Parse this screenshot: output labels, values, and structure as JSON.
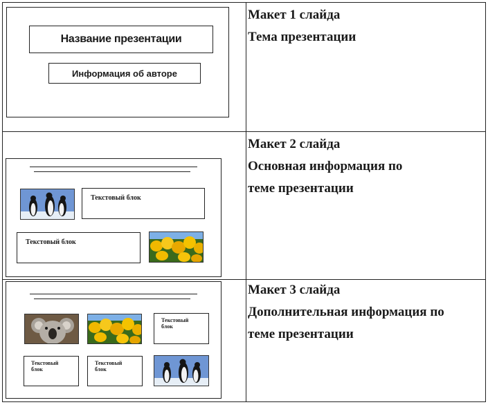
{
  "rows": [
    {
      "heading": "Макет 1 слайда",
      "lines": [
        "Тема презентации"
      ]
    },
    {
      "heading": "Макет 2 слайда",
      "lines": [
        "Основная информация по",
        "теме презентации"
      ]
    },
    {
      "heading": "Макет 3 слайда",
      "lines": [
        "Дополнительная информация по",
        "теме презентации"
      ]
    }
  ],
  "slide1": {
    "title_box": "Название презентации",
    "author_box": "Информация  об авторе"
  },
  "slide2": {
    "text_box_1": "Текстовый блок",
    "text_box_2": "Текстовый блок",
    "images": [
      "penguins",
      "tulips"
    ]
  },
  "slide3": {
    "text_box_1": [
      "Текстовый",
      "блок"
    ],
    "text_box_2": [
      "Текстовый",
      "блок"
    ],
    "text_box_3": [
      "Текстовый",
      "блок"
    ],
    "images": [
      "koala",
      "tulips",
      "penguins"
    ]
  },
  "colors": {
    "border": "#222222",
    "text": "#1a1a1a",
    "tulip": "#e8b400",
    "sky": "#5a86c8"
  }
}
